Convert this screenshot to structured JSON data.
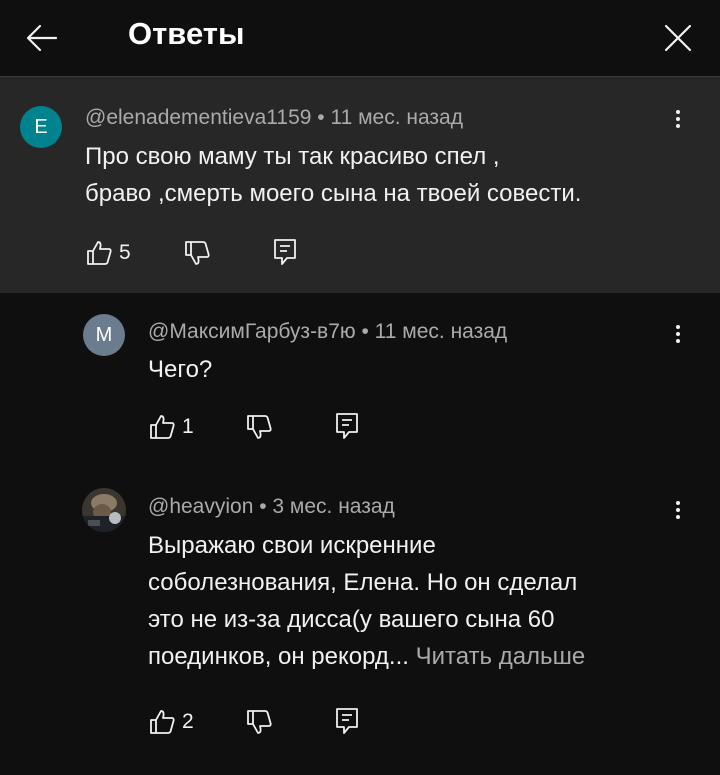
{
  "header": {
    "title": "Ответы"
  },
  "comments": [
    {
      "avatar_letter": "E",
      "avatar_color": "#00838f",
      "meta": "@elenadementieva1159 • 11 мес. назад",
      "text_lines": [
        "Про свою маму ты так красиво спел ,",
        "браво ,смерть моего сына на твоей совести."
      ],
      "likes": "5"
    },
    {
      "avatar_letter": "M",
      "avatar_color": "#6b7c8f",
      "meta": "@МаксимГарбуз-в7ю • 11 мес. назад",
      "text_lines": [
        "Чего?"
      ],
      "likes": "1"
    },
    {
      "meta": "@heavyion • 3 мес. назад",
      "text_lines": [
        "Выражаю свои искренние",
        "соболезнования, Елена. Но он сделал",
        "это не из-за дисса(у вашего сына 60",
        "поединков, он рекорд..."
      ],
      "read_more": "Читать дальше",
      "likes": "2"
    }
  ]
}
